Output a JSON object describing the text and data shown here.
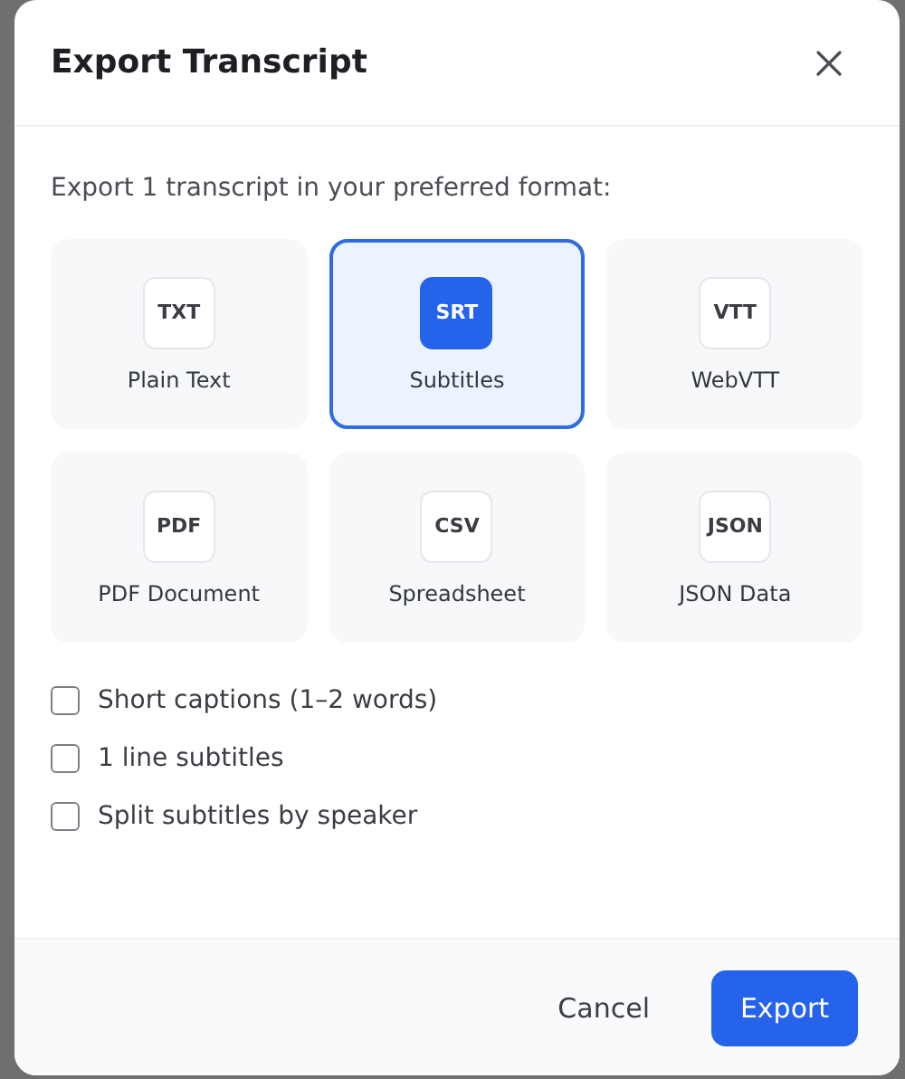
{
  "dialog": {
    "title": "Export Transcript",
    "intro": "Export 1 transcript in your preferred format:",
    "formats": [
      {
        "badge": "TXT",
        "label": "Plain Text",
        "selected": false
      },
      {
        "badge": "SRT",
        "label": "Subtitles",
        "selected": true
      },
      {
        "badge": "VTT",
        "label": "WebVTT",
        "selected": false
      },
      {
        "badge": "PDF",
        "label": "PDF Document",
        "selected": false
      },
      {
        "badge": "CSV",
        "label": "Spreadsheet",
        "selected": false
      },
      {
        "badge": "JSON",
        "label": "JSON Data",
        "selected": false
      }
    ],
    "options": [
      {
        "label": "Short captions (1–2 words)",
        "checked": false
      },
      {
        "label": "1 line subtitles",
        "checked": false
      },
      {
        "label": "Split subtitles by speaker",
        "checked": false
      }
    ],
    "buttons": {
      "cancel": "Cancel",
      "confirm": "Export"
    }
  }
}
